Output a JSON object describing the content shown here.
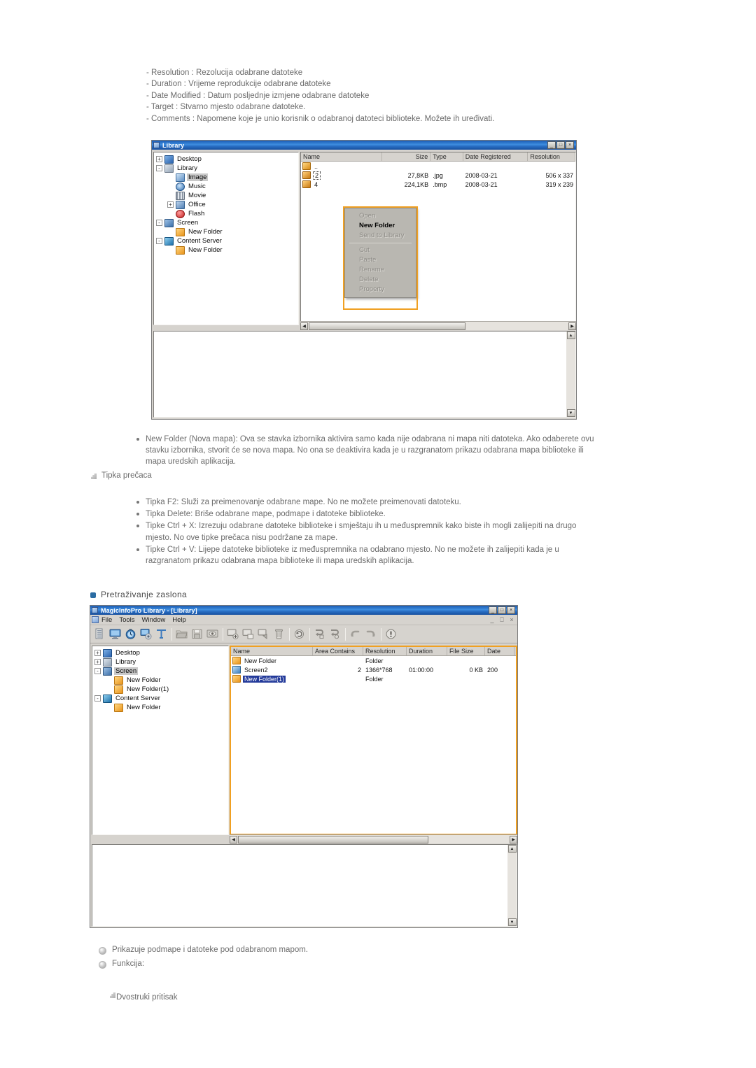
{
  "intro_lines": [
    "- Resolution : Rezolucija odabrane datoteke",
    "- Duration : Vrijeme reprodukcije odabrane datoteke",
    "- Date Modified : Datum posljednje izmjene odabrane datoteke",
    "- Target : Stvarno mjesto odabrane datoteke.",
    "- Comments : Napomene koje je unio korisnik o odabranoj datoteci biblioteke. Možete ih uređivati."
  ],
  "library_window": {
    "title": "Library",
    "buttons": {
      "minimize": "_",
      "maximize": "□",
      "close": "×"
    },
    "tree": [
      {
        "label": "Desktop",
        "expander": "+",
        "indent": 0,
        "icon": "desktop-icon",
        "state": "normal"
      },
      {
        "label": "Library",
        "expander": "-",
        "indent": 0,
        "icon": "library-icon",
        "state": "normal"
      },
      {
        "label": "Image",
        "expander": "",
        "indent": 1,
        "icon": "image-icon",
        "state": "selected-gray"
      },
      {
        "label": "Music",
        "expander": "",
        "indent": 1,
        "icon": "music-icon",
        "state": "normal"
      },
      {
        "label": "Movie",
        "expander": "",
        "indent": 1,
        "icon": "movie-icon",
        "state": "normal"
      },
      {
        "label": "Office",
        "expander": "+",
        "indent": 1,
        "icon": "office-icon",
        "state": "normal"
      },
      {
        "label": "Flash",
        "expander": "",
        "indent": 1,
        "icon": "flash-icon",
        "state": "normal"
      },
      {
        "label": "Screen",
        "expander": "-",
        "indent": 0,
        "icon": "screen-icon",
        "state": "normal"
      },
      {
        "label": "New Folder",
        "expander": "",
        "indent": 1,
        "icon": "folder-icon",
        "state": "normal"
      },
      {
        "label": "Content Server",
        "expander": "-",
        "indent": 0,
        "icon": "content-server-icon",
        "state": "normal"
      },
      {
        "label": "New Folder",
        "expander": "",
        "indent": 1,
        "icon": "folder-icon",
        "state": "normal"
      }
    ],
    "columns": [
      "Name",
      "Size",
      "Type",
      "Date Registered",
      "Resolution"
    ],
    "rows": [
      {
        "name": "..",
        "size": "",
        "type": "",
        "date": "",
        "resolution": "",
        "icon": "folder-up-icon",
        "marker": "none"
      },
      {
        "name": "2",
        "size": "27,8KB",
        "type": ".jpg",
        "date": "2008-03-21",
        "resolution": "506 x 337",
        "icon": "image-file-icon",
        "marker": "focus"
      },
      {
        "name": "4",
        "size": "224,1KB",
        "type": ".bmp",
        "date": "2008-03-21",
        "resolution": "319 x 239",
        "icon": "image-file-icon",
        "marker": "none"
      }
    ],
    "context_menu": [
      {
        "label": "Open",
        "enabled": false
      },
      {
        "label": "New Folder",
        "enabled": true
      },
      {
        "label": "Send to Library",
        "enabled": false
      },
      {
        "label": "---",
        "enabled": false
      },
      {
        "label": "Cut",
        "enabled": false
      },
      {
        "label": "Paste",
        "enabled": false
      },
      {
        "label": "Rename",
        "enabled": false
      },
      {
        "label": "Delete",
        "enabled": false
      },
      {
        "label": "Property",
        "enabled": false
      }
    ]
  },
  "newfolder_bullet": "New Folder (Nova mapa): Ova se stavka izbornika aktivira samo kada nije odabrana ni mapa niti datoteka. Ako odaberete ovu stavku izbornika, stvorit će se nova mapa. No ona se deaktivira kada je u razgranatom prikazu odabrana mapa biblioteke ili mapa uredskih aplikacija.",
  "shortcut_heading": "Tipka prečaca",
  "shortcut_items": [
    "Tipka F2: Služi za preimenovanje odabrane mape. No ne možete preimenovati datoteku.",
    "Tipka Delete: Briše odabrane mape, podmape i datoteke biblioteke.",
    "Tipke Ctrl + X: Izrezuju odabrane datoteke biblioteke i smještaju ih u međuspremnik kako biste ih mogli zalijepiti na drugo mjesto. No ove tipke prečaca nisu podržane za mape.",
    "Tipke Ctrl + V: Lijepe datoteke biblioteke iz međuspremnika na odabrano mjesto. No ne možete ih zalijepiti kada je u razgranatom prikazu odabrana mapa biblioteke ili mapa uredskih aplikacija."
  ],
  "section_title": "Pretraživanje zaslona",
  "magicinfo_window": {
    "title": "MagicInfoPro Library - [Library]",
    "buttons": {
      "minimize": "_",
      "maximize": "□",
      "close": "×"
    },
    "mdi_buttons": {
      "minimize": "_",
      "restore": "⎕",
      "close": "×"
    },
    "menus": [
      "File",
      "Tools",
      "Window",
      "Help"
    ],
    "toolbar_icons": [
      "content-list-icon",
      "screen-monitor-icon",
      "schedule-clock-icon",
      "settings-gear-icon",
      "text-tool-icon",
      "open-folder-icon",
      "save-icon",
      "preview-eye-icon",
      "add-screen-icon",
      "copy-screen-icon",
      "paste-screen-icon",
      "delete-trash-icon",
      "refresh-icon",
      "send-to-icon",
      "receive-from-icon",
      "undo-icon",
      "redo-icon",
      "info-icon"
    ],
    "tree": [
      {
        "label": "Desktop",
        "expander": "+",
        "indent": 0,
        "icon": "desktop-icon",
        "state": "normal"
      },
      {
        "label": "Library",
        "expander": "+",
        "indent": 0,
        "icon": "library-icon",
        "state": "normal"
      },
      {
        "label": "Screen",
        "expander": "-",
        "indent": 0,
        "icon": "screen-icon",
        "state": "selected-gray"
      },
      {
        "label": "New Folder",
        "expander": "",
        "indent": 1,
        "icon": "folder-icon",
        "state": "normal"
      },
      {
        "label": "New Folder(1)",
        "expander": "",
        "indent": 1,
        "icon": "folder-icon",
        "state": "normal"
      },
      {
        "label": "Content Server",
        "expander": "-",
        "indent": 0,
        "icon": "content-server-icon",
        "state": "normal"
      },
      {
        "label": "New Folder",
        "expander": "",
        "indent": 1,
        "icon": "folder-icon",
        "state": "normal"
      }
    ],
    "columns": [
      "Name",
      "Area Contains",
      "Resolution",
      "Duration",
      "File Size",
      "Date"
    ],
    "rows": [
      {
        "name": "New Folder",
        "area": "",
        "resolution": "Folder",
        "duration": "",
        "filesize": "",
        "date": "",
        "icon": "folder-icon",
        "selected": false
      },
      {
        "name": "Screen2",
        "area": "2",
        "resolution": "1366*768",
        "duration": "01:00:00",
        "filesize": "0 KB",
        "date": "200",
        "icon": "screen2-icon",
        "selected": false
      },
      {
        "name": "New Folder(1)",
        "area": "",
        "resolution": "Folder",
        "duration": "",
        "filesize": "",
        "date": "",
        "icon": "folder-icon",
        "selected": true
      }
    ]
  },
  "footer_items": [
    "Prikazuje podmape i datoteke pod odabranom mapom.",
    "Funkcija:"
  ],
  "footer_note": "Dvostruki pritisak"
}
